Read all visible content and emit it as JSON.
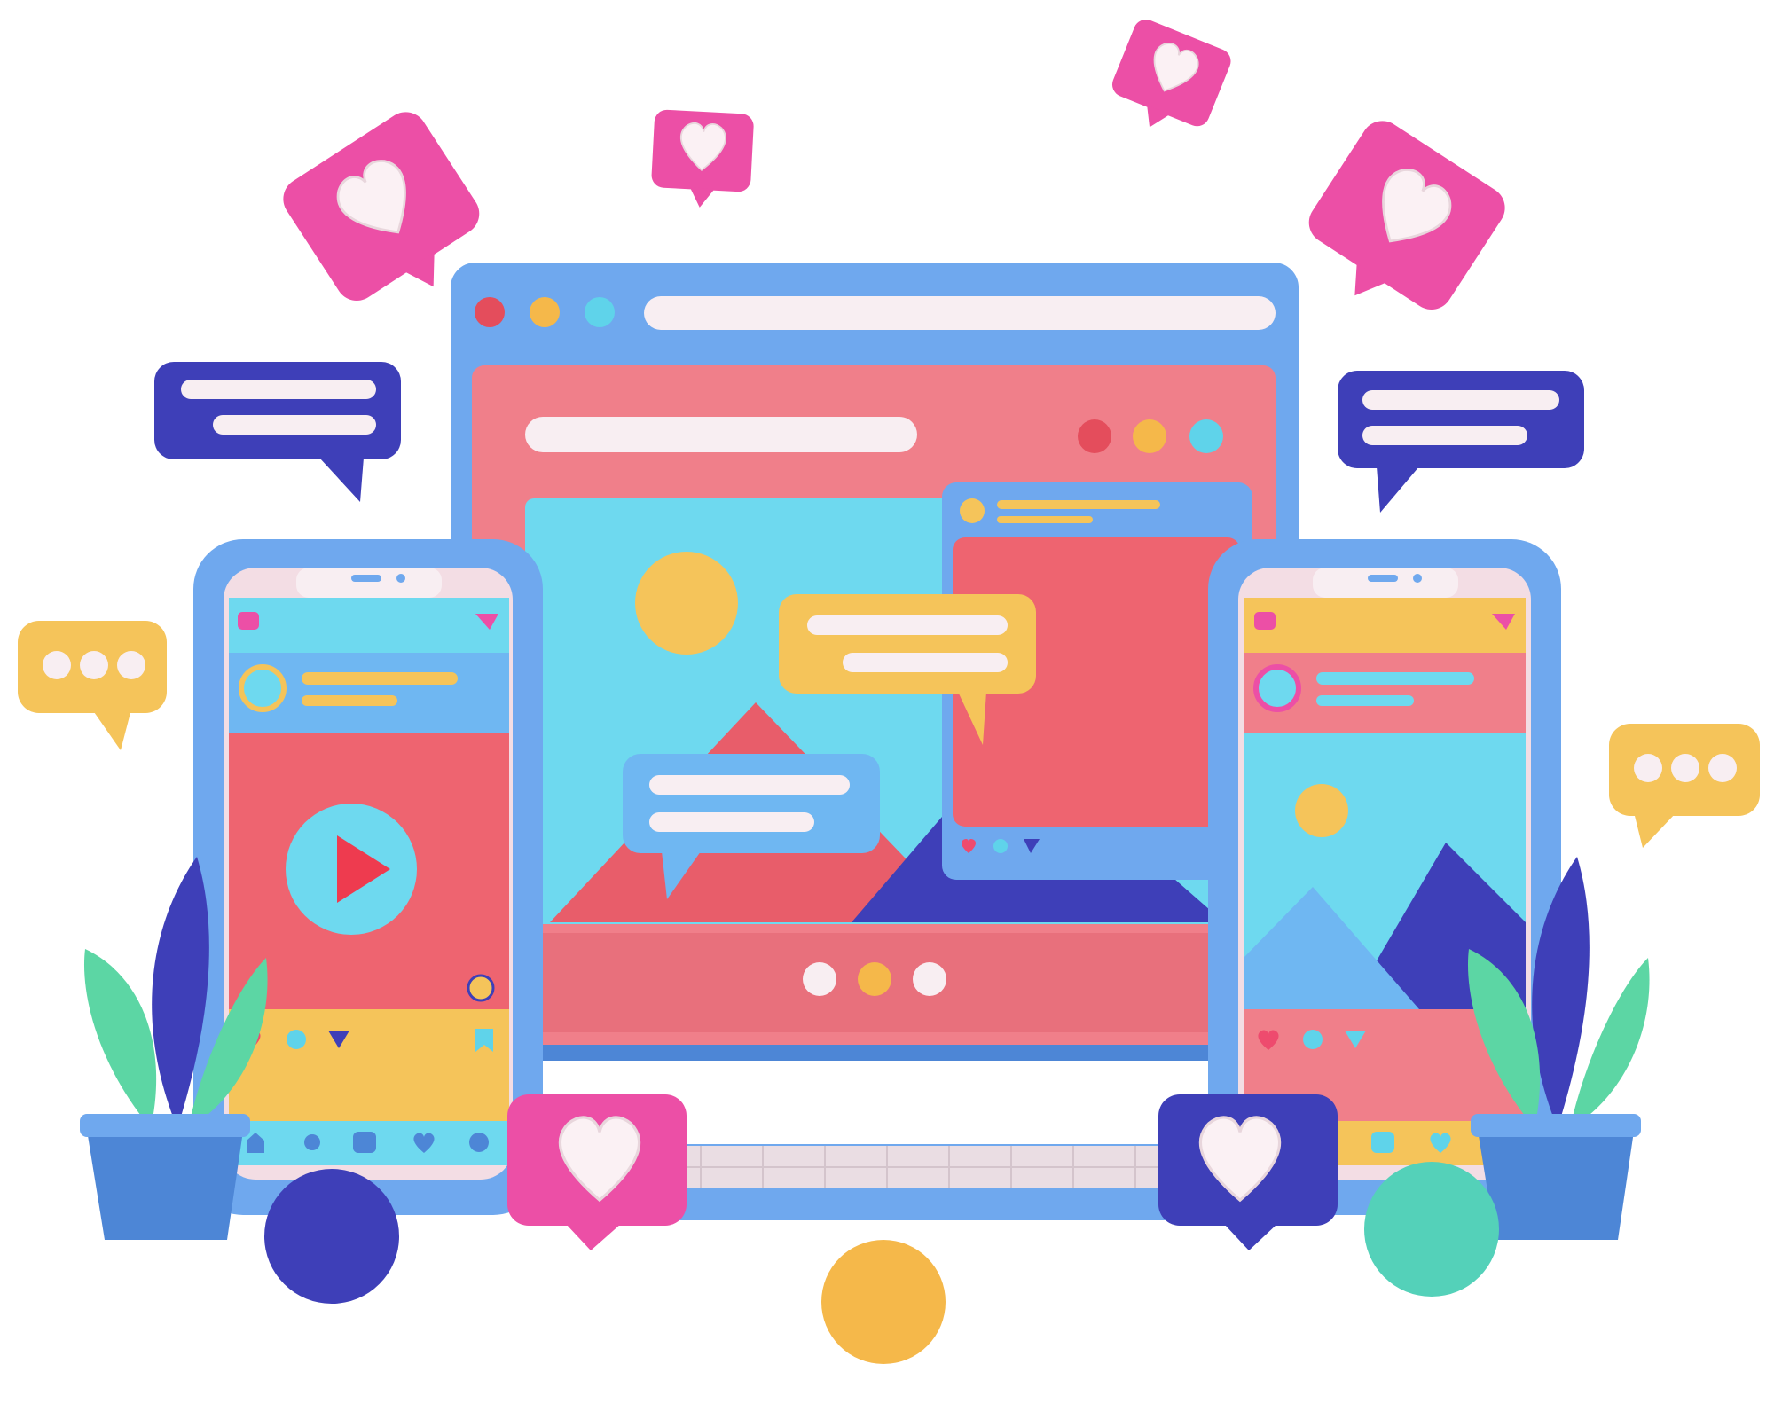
{
  "scene": {
    "description_text": "",
    "colors": {
      "background": "#ffffff",
      "frame_blue": "#6fa8ee",
      "frame_blue_dark": "#4d86d6",
      "screen_pink": "#f07f8a",
      "screen_red": "#ee6470",
      "cyan": "#6ed9ef",
      "yellow": "#f5c45a",
      "magenta": "#ec4fa6",
      "indigo": "#3e3fb8",
      "white_pill": "#f8eef2",
      "teal": "#54d1b9",
      "green_leaf": "#5cd6a4"
    },
    "icons": {
      "window_dots": [
        "close-dot-icon",
        "minimize-dot-icon",
        "maximize-dot-icon"
      ],
      "play": "play-icon",
      "heart": "heart-icon",
      "chat": "chat-bubble-icon",
      "typing": "typing-dots-icon",
      "home": "home-icon",
      "search": "search-icon",
      "add": "add-icon",
      "send": "send-icon",
      "bookmark": "bookmark-icon",
      "camera": "camera-icon",
      "speaker": "speaker-icon",
      "user": "user-avatar-icon",
      "image": "image-icon",
      "plant": "plant-icon"
    }
  }
}
